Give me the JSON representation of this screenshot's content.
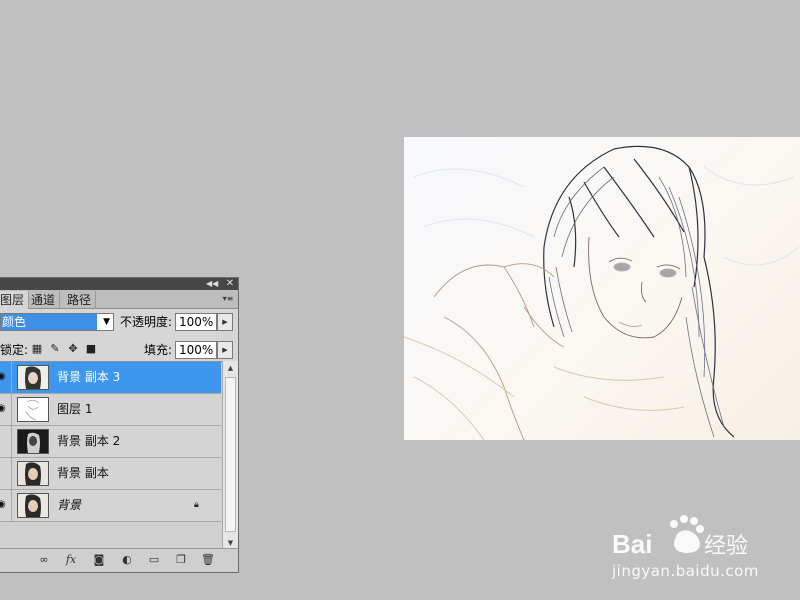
{
  "layers_panel": {
    "tabs": [
      "图层",
      "通道",
      "路径"
    ],
    "blend_mode": "颜色",
    "opacity_label": "不透明度:",
    "opacity_value": "100%",
    "lock_label": "锁定:",
    "fill_label": "填充:",
    "fill_value": "100%",
    "layers": [
      {
        "name": "背景 副本 3",
        "visible": true,
        "selected": true
      },
      {
        "name": "图层 1",
        "visible": true,
        "selected": false
      },
      {
        "name": "背景 副本 2",
        "visible": false,
        "selected": false
      },
      {
        "name": "背景 副本",
        "visible": false,
        "selected": false
      },
      {
        "name": "背景",
        "visible": true,
        "selected": false,
        "locked": true
      }
    ],
    "bottom_icons": [
      "link-icon",
      "fx-icon",
      "mask-icon",
      "adjustment-icon",
      "group-icon",
      "new-layer-icon",
      "trash-icon"
    ]
  },
  "watermark": {
    "logo_text": "Bai du 经验",
    "url": "jingyan.baidu.com"
  },
  "colors": {
    "workspace": "#c0c0c0",
    "selection": "#3d97ef",
    "panel": "#d6d6d6"
  }
}
